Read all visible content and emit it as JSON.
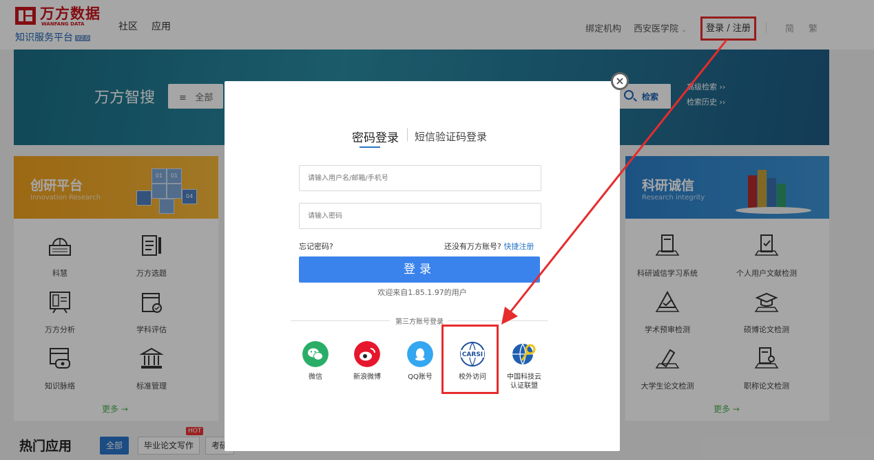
{
  "header": {
    "logo_cn": "万方数据",
    "logo_en": "WANFANG DATA",
    "logo_sub": "知识服务平台",
    "logo_version": "V2.0",
    "nav": [
      "社区",
      "应用"
    ],
    "bind_org_label": "绑定机构",
    "org_name": "西安医学院",
    "login_register": "登录 / 注册",
    "lang_simplified": "简",
    "lang_traditional": "繁"
  },
  "banner": {
    "title": "万方智搜",
    "search_scope": "全部",
    "search_button": "检索",
    "advanced_search": "高级检索",
    "search_history": "检索历史"
  },
  "left_panel": {
    "title": "创研平台",
    "subtitle": "Innovation Research",
    "cube_labels": [
      "01",
      "01",
      "04"
    ],
    "apps": [
      {
        "label": "科慧",
        "icon": "keyboard-globe-icon"
      },
      {
        "label": "万方选题",
        "icon": "document-pen-icon"
      },
      {
        "label": "万方分析",
        "icon": "chart-screen-icon"
      },
      {
        "label": "学科评估",
        "icon": "calendar-check-icon"
      },
      {
        "label": "知识脉络",
        "icon": "card-link-icon"
      },
      {
        "label": "标准管理",
        "icon": "building-icon"
      }
    ],
    "more": "更多 →"
  },
  "right_panel": {
    "title": "科研诚信",
    "subtitle": "Research integrity",
    "apps": [
      {
        "label": "科研诚信学习系统",
        "icon": "book-study-icon"
      },
      {
        "label": "个人用户文献检测",
        "icon": "document-check-icon"
      },
      {
        "label": "学术预审检测",
        "icon": "triangle-check-icon"
      },
      {
        "label": "硕博论文检测",
        "icon": "graduation-cap-icon"
      },
      {
        "label": "大学生论文检测",
        "icon": "pen-paper-icon"
      },
      {
        "label": "职称论文检测",
        "icon": "document-user-icon"
      }
    ],
    "more": "更多 →"
  },
  "hot": {
    "title": "热门应用",
    "tabs": [
      "全部",
      "毕业论文写作",
      "考研"
    ],
    "badge": "HOT"
  },
  "modal": {
    "tab_password": "密码登录",
    "tab_sms": "短信验证码登录",
    "username_placeholder": "请输入用户名/邮箱/手机号",
    "password_placeholder": "请输入密码",
    "forgot": "忘记密码?",
    "no_account": "还没有万方账号?",
    "quick_register": "快捷注册",
    "login_button": "登录",
    "welcome": "欢迎来自1.85.1.97的用户",
    "third_party_label": "第三方账号登录",
    "third_party": [
      {
        "label": "微信",
        "icon": "wechat-icon",
        "color": "#2aae67"
      },
      {
        "label": "新浪微博",
        "icon": "weibo-icon",
        "color": "#e6162d"
      },
      {
        "label": "QQ账号",
        "icon": "qq-icon",
        "color": "#35a6f0"
      },
      {
        "label": "校外访问",
        "icon": "carsi-icon",
        "color": "#1c4e9a",
        "badge_text": "CARSI"
      },
      {
        "label": "中国科技云\n认证联盟",
        "icon": "cstcloud-icon",
        "color": "#1f5fb0"
      }
    ]
  },
  "colors": {
    "brand_red": "#c8161d",
    "login_blue": "#3a83ec",
    "annotation_red": "#e62c2c",
    "panel_orange": "#f0a01e",
    "panel_blue": "#2b7fc9"
  }
}
